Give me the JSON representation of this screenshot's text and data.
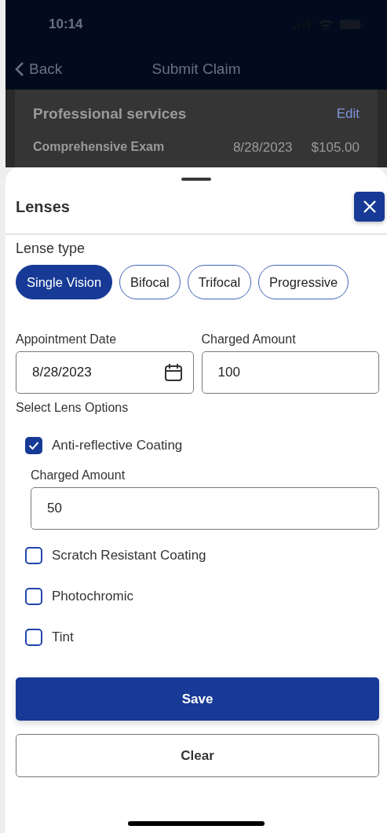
{
  "status_bar": {
    "time": "10:14"
  },
  "nav": {
    "back": "Back",
    "title": "Submit Claim"
  },
  "background_card": {
    "title": "Professional services",
    "action": "Edit",
    "rows": [
      {
        "name": "Comprehensive Exam",
        "date": "8/28/2023",
        "amount": "$105.00"
      }
    ]
  },
  "sheet": {
    "title": "Lenses",
    "lens_type": {
      "label": "Lense type",
      "options": [
        {
          "label": "Single Vision",
          "selected": true
        },
        {
          "label": "Bifocal",
          "selected": false
        },
        {
          "label": "Trifocal",
          "selected": false
        },
        {
          "label": "Progressive",
          "selected": false
        }
      ]
    },
    "fields": [
      {
        "label": "Appointment Date",
        "value": "8/28/2023",
        "kind": "date"
      },
      {
        "label": "Charged Amount",
        "value": "100",
        "kind": "text"
      }
    ],
    "options_label": "Select Lens Options",
    "options": [
      {
        "label": "Anti-reflective Coating",
        "checked": true,
        "amount": {
          "label": "Charged Amount",
          "value": "50"
        }
      },
      {
        "label": "Scratch Resistant Coating",
        "checked": false
      },
      {
        "label": "Photochromic",
        "checked": false
      },
      {
        "label": "Tint",
        "checked": false
      }
    ],
    "buttons": [
      {
        "label": "Save",
        "kind": "primary"
      },
      {
        "label": "Clear",
        "kind": "secondary"
      }
    ]
  }
}
